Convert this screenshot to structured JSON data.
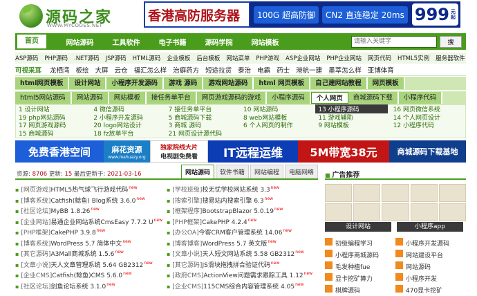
{
  "logo": {
    "name": "源码之家",
    "url": "WWW.MYCODES.NET"
  },
  "top_ad": {
    "main": "香港高防服务器",
    "tag1": "100G 超高防御",
    "tag2": "CN2 直连稳定 20ms",
    "price": "999",
    "unit": "元",
    "per": "起"
  },
  "nav": {
    "items": [
      "首页",
      "网站源码",
      "工具软件",
      "电子书籍",
      "源码学院",
      "网站模板"
    ],
    "search_placeholder": "请输入关键字",
    "search_button": "搜"
  },
  "cat1": [
    "ASP源码",
    "PHP源码",
    ".NET源码",
    "JSP源码",
    "HTML源码",
    "企业模板",
    "后台模板",
    "网站菜单",
    "PHP游戏",
    "ASP企业网站",
    "PHP企业网站",
    "网页代码",
    "HTML5实例",
    "服务器软件"
  ],
  "cat2": [
    "可视采耳",
    "龙栖湾",
    "板绘",
    "大屏",
    "云仓",
    "福汇怎么样",
    "治癖药方",
    "短途拉货",
    "泰治",
    "电霸",
    "药士",
    "港航一建",
    "墨萃怎么样",
    "亚博体育"
  ],
  "tab1": [
    "html网页模板",
    "设计网站",
    "小程序开发源码",
    "游戏 源码",
    "游戏网站源码",
    "html 网页模板",
    "自己建网站教程",
    "网页模板"
  ],
  "tab2": [
    "html5网站源码",
    "网站源码",
    "网站模板",
    "接任务单平台",
    "网页游戏源码的游戏",
    "小程序源码",
    "个人网页",
    "商城源码下载",
    "小程序代码"
  ],
  "grid": [
    "1 设计网站",
    "4 微信源码",
    "7 接任务单平台",
    "10 网站源码",
    "13 小程序源码",
    "16 网页微信系统",
    "19 php网站源码",
    "2 小程序开发源码",
    "5 商城源码下载",
    "8 web网站模板",
    "11 游戏辅助",
    "14 个人网页设计",
    "17 网页游戏源码",
    "20 logo网站设计",
    "3 商城 源码",
    "6 个人网页的制作",
    "9 网站模板",
    "12 小程序代码",
    "15 商城源码",
    "18 fz放单平台",
    "21 网页设计源代码"
  ],
  "ads": {
    "a1": "免费香港空间",
    "a2_top": "麻花资源",
    "a2_bottom": "www.mahuazy.org",
    "a3_top": "独家院线大片",
    "a3_bottom": "电视剧免费看",
    "a4": "IT远程运维",
    "a5": "5M带宽38元",
    "a6": "商城源码下载基地"
  },
  "stats": {
    "res_label": "资源:",
    "res": "8706",
    "upd_label": "更新:",
    "upd": "15",
    "date_label": "最后更新于:",
    "date": "2021-03-16"
  },
  "left_tabs": [
    "网站源码",
    "软件书籍",
    "网站编程",
    "电脑网络"
  ],
  "left_list": [
    {
      "tag": "[网页游戏]",
      "title": "HTML5热气球飞行游戏代码"
    },
    {
      "tag": "[博客系统]",
      "title": "Catfish(鲶鱼) Blog系统 3.6.0"
    },
    {
      "tag": "[社区论坛]",
      "title": "MyBB 1.8.26"
    },
    {
      "tag": "[企业网站]",
      "title": "易通企业网站系统CmsEasy 7.7.2 U"
    },
    {
      "tag": "[PHP框架]",
      "title": "CakePHP 3.9.8"
    },
    {
      "tag": "[博客系统]",
      "title": "WordPress 5.7 简体中文"
    },
    {
      "tag": "[其它源码]",
      "title": "A3Mall商城系统 1.5.6"
    },
    {
      "tag": "[文章小说]",
      "title": "天人文章管理系统 5.64 GB2312"
    },
    {
      "tag": "[企业CMS]",
      "title": "Catfish(鲶鱼)CMS 5.6.0"
    },
    {
      "tag": "[社区论坛]",
      "title": "剑鱼论坛系统 3.1.0"
    },
    {
      "tag": "[学校班级]",
      "title": "校无忧学校网站系统 3.3"
    },
    {
      "tag": "[搜索引擎]",
      "title": "搜易站内搜索引擎 6.3"
    },
    {
      "tag": "[框架程序]",
      "title": "BootstrapBlazor 5.0.19"
    },
    {
      "tag": "[PHP框架]",
      "title": "CakePHP 4.2.4"
    },
    {
      "tag": "[办公OA]",
      "title": "今客CRM客户管理系统 14.06"
    },
    {
      "tag": "[博客博客]",
      "title": "WordPress 5.7 英文版"
    },
    {
      "tag": "[文章小说]",
      "title": "天人短文网站系统 5.58 GB2312"
    },
    {
      "tag": "[其它源码]",
      "title": "JS滑块拖拽拼合验证代码"
    },
    {
      "tag": "[政府CMS]",
      "title": "ActionView问题需求跟踪工具 1.12"
    },
    {
      "tag": "[企业CMS]",
      "title": "115CMS综合内容管理系统 4.05"
    }
  ],
  "new_label": "new",
  "right": {
    "head": "广告推荐",
    "label1": "设计网站",
    "label2": "小程序app",
    "items": [
      "初级编程学习",
      "小程序开发源码",
      "小程序商城源码",
      "网站建设平台",
      "毛发种植fue",
      "网站源码",
      "显卡挖矿算力",
      "小程序开发",
      "棋牌源码",
      "470显卡挖矿"
    ]
  }
}
